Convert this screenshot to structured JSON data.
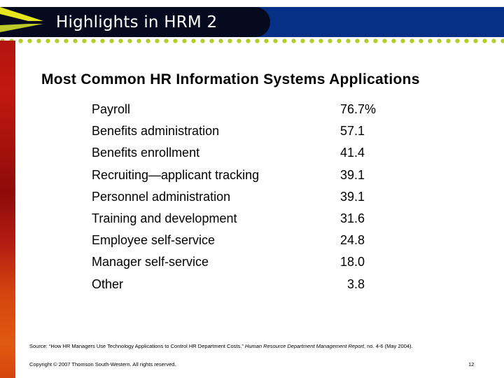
{
  "header": {
    "title": "Highlights in HRM 2",
    "colors": {
      "bar": "#062f86",
      "pill": "#050a1f",
      "accent_dots": "#b4cc2c",
      "logo": "#e6e61e",
      "left_strip": "#b3140f"
    }
  },
  "slide": {
    "title": "Most Common HR Information Systems Applications",
    "items": [
      {
        "label": "Payroll",
        "value": "76.7%"
      },
      {
        "label": "Benefits administration",
        "value": "57.1"
      },
      {
        "label": "Benefits enrollment",
        "value": "41.4"
      },
      {
        "label": "Recruiting—applicant tracking",
        "value": "39.1"
      },
      {
        "label": "Personnel administration",
        "value": "39.1"
      },
      {
        "label": "Training and development",
        "value": "31.6"
      },
      {
        "label": "Employee self-service",
        "value": "24.8"
      },
      {
        "label": "Manager self-service",
        "value": "18.0"
      },
      {
        "label": "Other",
        "value": "  3.8"
      }
    ]
  },
  "footer": {
    "source_prefix": "Source: “How HR Managers Use Technology Applications to Control HR Department Costs.” ",
    "source_publication": "Human Resource Department Management Report",
    "source_suffix": ", no. 4-6 (May 2004).",
    "copyright": "Copyright © 2007 Thomson South-Western. All rights reserved.",
    "page_number": "12"
  }
}
